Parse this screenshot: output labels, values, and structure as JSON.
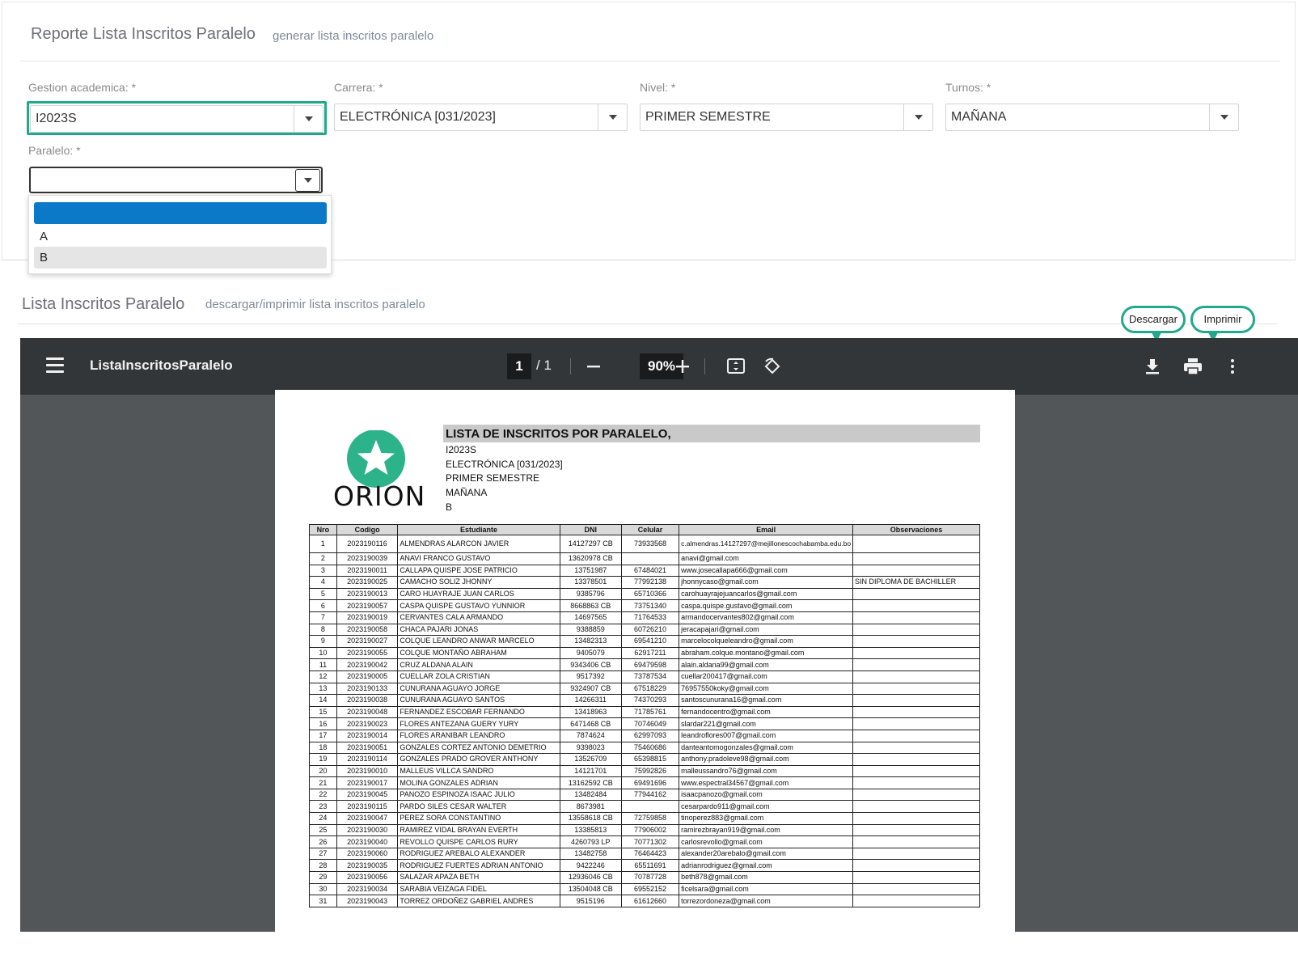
{
  "form": {
    "title": "Reporte Lista Inscritos Paralelo",
    "subtitle": "generar lista inscritos paralelo",
    "gestion_label": "Gestion academica:  *",
    "gestion_value": "I2023S",
    "carrera_label": "Carrera:  *",
    "carrera_value": "ELECTRÓNICA [031/2023]",
    "nivel_label": "Nivel:  *",
    "nivel_value": "PRIMER SEMESTRE",
    "turnos_label": "Turnos:  *",
    "turnos_value": "MAÑANA",
    "paralelo_label": "Paralelo:  *",
    "paralelo_value": "",
    "paralelo_options": [
      "",
      "A",
      "B"
    ]
  },
  "report_panel": {
    "title": "Lista Inscritos Paralelo",
    "subtitle": "descargar/imprimir lista inscritos paralelo"
  },
  "viewer": {
    "doc_name": "ListaInscritosParalelo",
    "page_current": "1",
    "page_total": "/  1",
    "zoom": "90%",
    "callout_download": "Descargar",
    "callout_print": "Imprimir"
  },
  "report": {
    "logo_text": "ORION",
    "title": "LISTA DE INSCRITOS POR PARALELO,",
    "lines": [
      "I2023S",
      "ELECTRÓNICA [031/2023]",
      "PRIMER SEMESTRE",
      "MAÑANA",
      "B"
    ],
    "headers": [
      "Nro",
      "Codigo",
      "Estudiante",
      "DNI",
      "Celular",
      "Email",
      "Observaciones"
    ],
    "rows": [
      [
        "1",
        "2023190116",
        "ALMENDRAS ALARCON JAVIER",
        "14127297 CB",
        "73933568",
        "c.almendras.14127297@mejillonescochabamba.edu.bo",
        ""
      ],
      [
        "2",
        "2023190039",
        "ANAVI FRANCO GUSTAVO",
        "13620978 CB",
        "",
        "anavi@gmail.com",
        ""
      ],
      [
        "3",
        "2023190011",
        "CALLAPA QUISPE JOSE PATRICIO",
        "13751987",
        "67484021",
        "www.josecallapa666@gmail.com",
        ""
      ],
      [
        "4",
        "2023190025",
        "CAMACHO SOLIZ JHONNY",
        "13378501",
        "77992138",
        "jhonnycaso@gmail.com",
        "SIN DIPLOMA DE BACHILLER"
      ],
      [
        "5",
        "2023190013",
        "CARO HUAYRAJE JUAN CARLOS",
        "9385796",
        "65710366",
        "carohuayrajejuancarlos@gmail.com",
        ""
      ],
      [
        "6",
        "2023190057",
        "CASPA QUISPE GUSTAVO YUNNIOR",
        "8668863 CB",
        "73751340",
        "caspa.quispe.gustavo@gmail.com",
        ""
      ],
      [
        "7",
        "2023190019",
        "CERVANTES CALA ARMANDO",
        "14697565",
        "71764533",
        "armandocervantes802@gmail.com",
        ""
      ],
      [
        "8",
        "2023190058",
        "CHACA PAJARI JONAS",
        "9388859",
        "60726210",
        "jeracapajari@gmail.com",
        ""
      ],
      [
        "9",
        "2023190027",
        "COLQUE LEANDRO ANWAR MARCELO",
        "13482313",
        "69541210",
        "marcelocolqueleandro@gmail.com",
        ""
      ],
      [
        "10",
        "2023190055",
        "COLQUE MONTAÑO ABRAHAM",
        "9405079",
        "62917211",
        "abraham.colque.montano@gmail.com",
        ""
      ],
      [
        "11",
        "2023190042",
        "CRUZ ALDANA ALAIN",
        "9343406 CB",
        "69479598",
        "alain.aldana99@gmail.com",
        ""
      ],
      [
        "12",
        "2023190005",
        "CUELLAR ZOLA CRISTIAN",
        "9517392",
        "73787534",
        "cuellar200417@gmail.com",
        ""
      ],
      [
        "13",
        "2023190133",
        "CUNURANA AGUAYO JORGE",
        "9324907 CB",
        "67518229",
        "76957550koky@gmail.com",
        ""
      ],
      [
        "14",
        "2023190038",
        "CUNURANA AGUAYO SANTOS",
        "14266311",
        "74370293",
        "santoscunurana16@gmail.com",
        ""
      ],
      [
        "15",
        "2023190048",
        "FERNANDEZ ESCOBAR FERNANDO",
        "13418963",
        "71785761",
        "fernandocentro@gmail.com",
        ""
      ],
      [
        "16",
        "2023190023",
        "FLORES ANTEZANA GUERY YURY",
        "6471468 CB",
        "70746049",
        "slardar221@gmail.com",
        ""
      ],
      [
        "17",
        "2023190014",
        "FLORES ARANIBAR LEANDRO",
        "7874624",
        "62997093",
        "leandroflores007@gmail.com",
        ""
      ],
      [
        "18",
        "2023190051",
        "GONZALES CORTEZ ANTONIO DEMETRIO",
        "9398023",
        "75460686",
        "danteantomogonzales@gmail.com",
        ""
      ],
      [
        "19",
        "2023190114",
        "GONZALES PRADO GROVER ANTHONY",
        "13526709",
        "65398815",
        "anthony.pradoleve98@gmail.com",
        ""
      ],
      [
        "20",
        "2023190010",
        "MALLEUS VILLCA SANDRO",
        "14121701",
        "75992826",
        "malleussandro76@gmail.com",
        ""
      ],
      [
        "21",
        "2023190017",
        "MOLINA GONZALES ADRIAN",
        "13162592 CB",
        "69491696",
        "www.espectral34567@gmail.com",
        ""
      ],
      [
        "22",
        "2023190045",
        "PANOZO ESPINOZA ISAAC JULIO",
        "13482484",
        "77944162",
        "isaacpanozo@gmail.com",
        ""
      ],
      [
        "23",
        "2023190115",
        "PARDO SILES CESAR WALTER",
        "8673981",
        "",
        "cesarpardo911@gmail.com",
        ""
      ],
      [
        "24",
        "2023190047",
        "PEREZ SORA CONSTANTINO",
        "13558618 CB",
        "72759858",
        "tinoperez883@gmail.com",
        ""
      ],
      [
        "25",
        "2023190030",
        "RAMIREZ VIDAL BRAYAN EVERTH",
        "13385813",
        "77906002",
        "ramirezbrayan919@gmail.com",
        ""
      ],
      [
        "26",
        "2023190040",
        "REVOLLO QUISPE CARLOS RURY",
        "4260793 LP",
        "70771302",
        "carlosrevollo@gmail.com",
        ""
      ],
      [
        "27",
        "2023190060",
        "RODRIGUEZ AREBALO ALEXANDER",
        "13482758",
        "76464423",
        "alexander20arebalo@gmail.com",
        ""
      ],
      [
        "28",
        "2023190035",
        "RODRIGUEZ FUERTES ADRIAN ANTONIO",
        "9422246",
        "65511691",
        "adrianrodriguez@gmail.com",
        ""
      ],
      [
        "29",
        "2023190056",
        "SALAZAR APAZA BETH",
        "12936046 CB",
        "70787728",
        "beth878@gmail.com",
        ""
      ],
      [
        "30",
        "2023190034",
        "SARABIA VEIZAGA FIDEL",
        "13504048 CB",
        "69552152",
        "ficelsara@gmail.com",
        ""
      ],
      [
        "31",
        "2023190043",
        "TORREZ ORDOÑEZ GABRIEL ANDRES",
        "9515196",
        "61612660",
        "torrezordoneza@gmail.com",
        ""
      ]
    ]
  },
  "colors": {
    "accent_green": "#22a88a",
    "dropdown_selected": "#0b79c8",
    "toolbar_bg": "#323639",
    "viewer_bg": "#525659",
    "logo_green": "#2db389"
  },
  "icons": [
    "menu-icon",
    "minus-icon",
    "plus-icon",
    "fit-page-icon",
    "rotate-icon",
    "download-icon",
    "print-icon",
    "more-vert-icon",
    "star-logo-icon"
  ]
}
